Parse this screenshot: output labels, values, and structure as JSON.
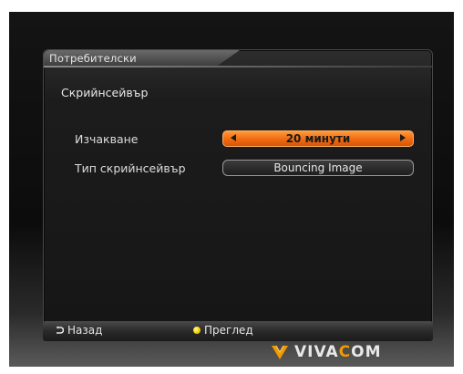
{
  "tab": {
    "title": "Потребителски"
  },
  "page": {
    "subtitle": "Скрийнсейвър"
  },
  "settings": [
    {
      "label": "Изчакване",
      "value": "20 минути"
    },
    {
      "label": "Тип скрийнсейвър",
      "value": "Bouncing Image"
    }
  ],
  "footer": {
    "back_label": "Назад",
    "preview_label": "Преглед"
  },
  "logo": {
    "text_before": "VIVA",
    "text_accent": "C",
    "text_after": "OM"
  },
  "colors": {
    "highlight": "#f06a10",
    "preview_dot": "#f5d400",
    "logo_accent": "#f29a00"
  }
}
